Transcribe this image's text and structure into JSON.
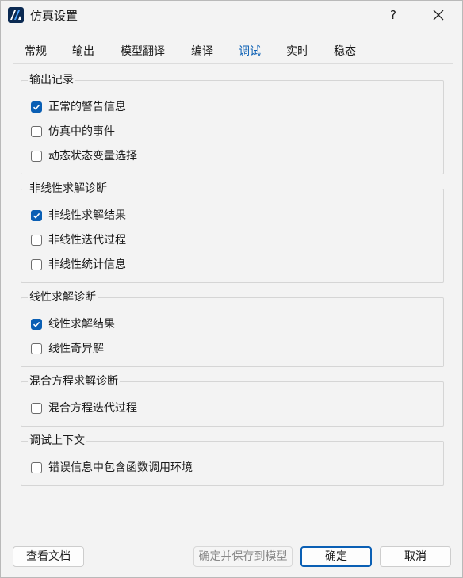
{
  "window": {
    "title": "仿真设置",
    "help": "?"
  },
  "tabs": [
    {
      "label": "常规",
      "active": false
    },
    {
      "label": "输出",
      "active": false
    },
    {
      "label": "模型翻译",
      "active": false
    },
    {
      "label": "编译",
      "active": false
    },
    {
      "label": "调试",
      "active": true
    },
    {
      "label": "实时",
      "active": false
    },
    {
      "label": "稳态",
      "active": false
    }
  ],
  "groups": {
    "output_log": {
      "title": "输出记录",
      "items": [
        {
          "label": "正常的警告信息",
          "checked": true
        },
        {
          "label": "仿真中的事件",
          "checked": false
        },
        {
          "label": "动态状态变量选择",
          "checked": false
        }
      ]
    },
    "nonlinear": {
      "title": "非线性求解诊断",
      "items": [
        {
          "label": "非线性求解结果",
          "checked": true
        },
        {
          "label": "非线性迭代过程",
          "checked": false
        },
        {
          "label": "非线性统计信息",
          "checked": false
        }
      ]
    },
    "linear": {
      "title": "线性求解诊断",
      "items": [
        {
          "label": "线性求解结果",
          "checked": true
        },
        {
          "label": "线性奇异解",
          "checked": false
        }
      ]
    },
    "mixed": {
      "title": "混合方程求解诊断",
      "items": [
        {
          "label": "混合方程迭代过程",
          "checked": false
        }
      ]
    },
    "context": {
      "title": "调试上下文",
      "items": [
        {
          "label": "错误信息中包含函数调用环境",
          "checked": false
        }
      ]
    }
  },
  "footer": {
    "view_docs": "查看文档",
    "save_to_model": "确定并保存到模型",
    "ok": "确定",
    "cancel": "取消"
  },
  "colors": {
    "accent": "#0a5fb4",
    "background": "#f3f3f3",
    "logo": "#0b2a52"
  }
}
